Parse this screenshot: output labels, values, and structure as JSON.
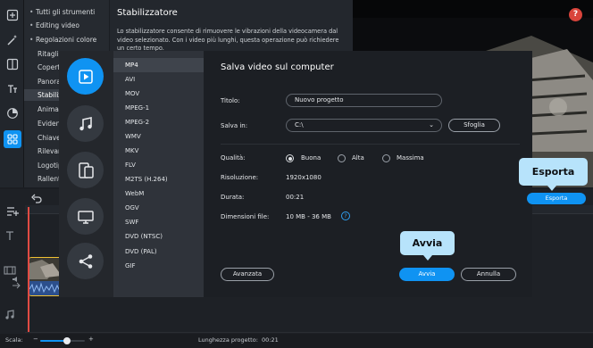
{
  "colors": {
    "accent": "#0f93f2",
    "help": "#d9443b",
    "playhead": "#e14b43",
    "clip_border": "#f1c232",
    "tooltip": "#b7e3fb"
  },
  "rail": {
    "icons": [
      "import-icon",
      "magic-wand-icon",
      "transitions-icon",
      "titles-icon",
      "clock-icon",
      "more-tools-icon"
    ]
  },
  "menu": {
    "items": [
      {
        "label": "Tutti gli strumenti",
        "kind": "category"
      },
      {
        "label": "Editing video",
        "kind": "category"
      },
      {
        "label": "Regolazioni colore",
        "kind": "category"
      },
      {
        "label": "Ritagli",
        "kind": "item"
      },
      {
        "label": "Copertu",
        "kind": "item"
      },
      {
        "label": "Panoran",
        "kind": "item"
      },
      {
        "label": "Stabilizz",
        "kind": "item",
        "active": true
      },
      {
        "label": "Animazi",
        "kind": "item"
      },
      {
        "label": "Evidenz",
        "kind": "item"
      },
      {
        "label": "Chiave",
        "kind": "item"
      },
      {
        "label": "Rilevam",
        "kind": "item"
      },
      {
        "label": "Logotip",
        "kind": "item"
      },
      {
        "label": "Rallent",
        "kind": "item"
      }
    ]
  },
  "stabilizer": {
    "title": "Stabilizzatore",
    "description": "Lo stabilizzatore consente di rimuovere le vibrazioni della videocamera dal video selezionato. Con i video più lunghi, questa operazione può richiedere un certo tempo."
  },
  "preview": {
    "help_label": "?",
    "export_label": "Esporta"
  },
  "dialog": {
    "formats": [
      "MP4",
      "AVI",
      "MOV",
      "MPEG-1",
      "MPEG-2",
      "WMV",
      "MKV",
      "FLV",
      "M2TS (H.264)",
      "WebM",
      "OGV",
      "SWF",
      "DVD (NTSC)",
      "DVD (PAL)",
      "GIF"
    ],
    "selected_format": "MP4",
    "format_buttons": [
      "video-file-icon",
      "audio-icon",
      "devices-icon",
      "tv-icon",
      "share-icon"
    ],
    "title": "Salva video sul computer",
    "labels": {
      "title": "Titolo:",
      "save_in": "Salva in:",
      "quality": "Qualità:",
      "resolution": "Risoluzione:",
      "duration": "Durata:",
      "file_size": "Dimensioni file:"
    },
    "title_value": "Nuovo progetto",
    "save_in_value": "C:\\",
    "browse_label": "Sfoglia",
    "quality_options": [
      "Buona",
      "Alta",
      "Massima"
    ],
    "quality_selected": "Buona",
    "resolution_value": "1920x1080",
    "duration_value": "00:21",
    "file_size_value": "10 MB - 36 MB",
    "info_label": "?",
    "advanced_label": "Avanzata",
    "start_label": "Avvia",
    "cancel_label": "Annulla"
  },
  "tooltips": {
    "avvia": "Avvia",
    "esporta": "Esporta"
  },
  "status": {
    "scale_label": "Scala:",
    "project_length": "Lunghezza progetto:",
    "project_length_value": "00:21"
  }
}
